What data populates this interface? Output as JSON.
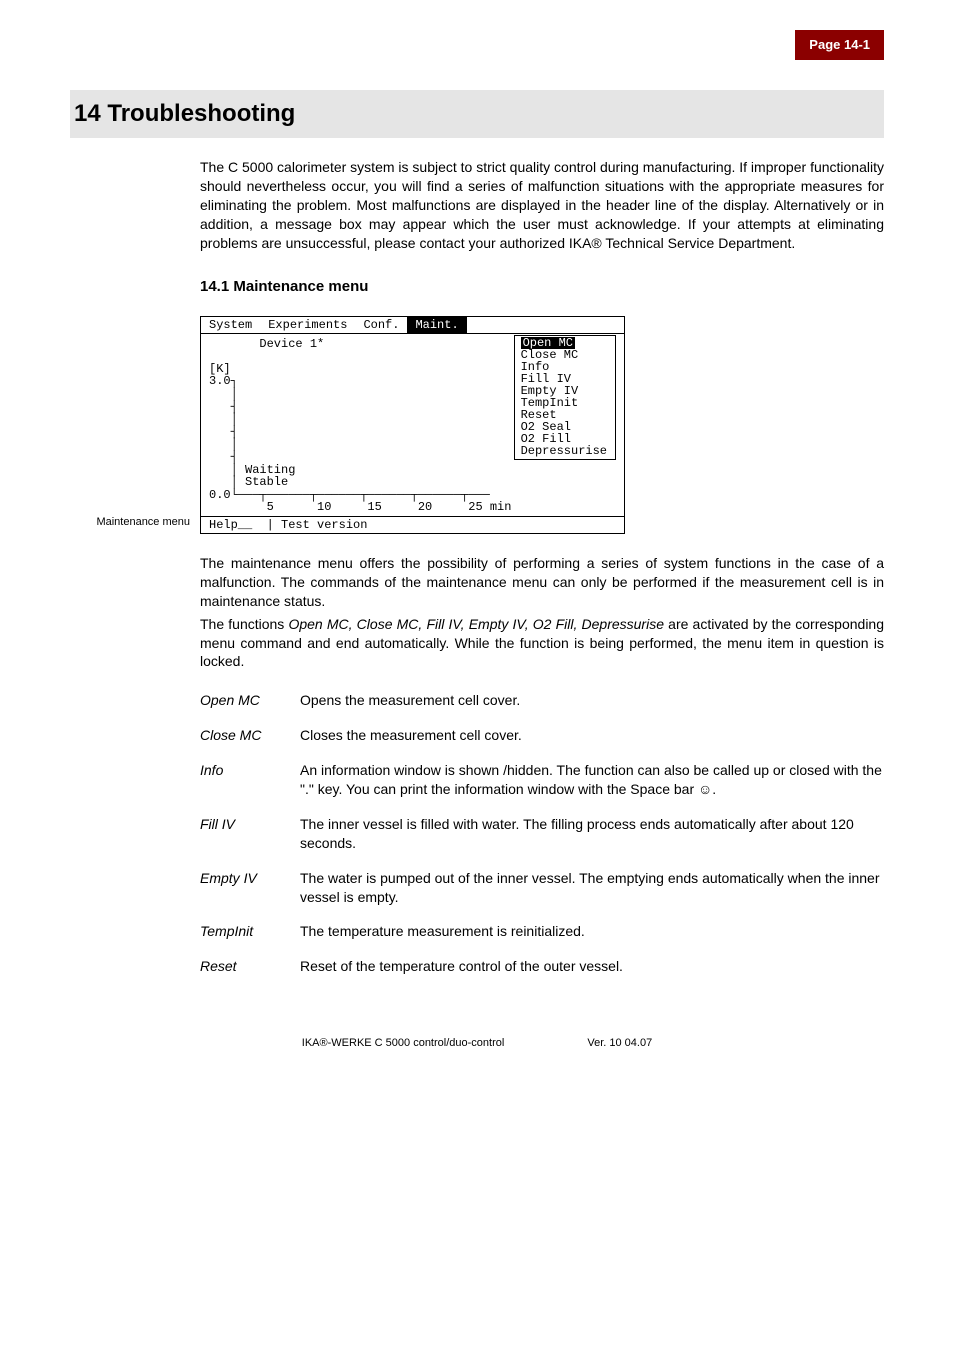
{
  "page_tag": "Page 14-1",
  "h1": "14 Troubleshooting",
  "intro": "The C 5000 calorimeter system is subject to strict quality control during manufacturing. If improper functionality should nevertheless occur, you will find a series of malfunction situations with the appropriate measures for eliminating the problem. Most malfunctions are displayed in the header line of the display. Alternatively or in addition, a message box may appear which the user must acknowledge. If your attempts at eliminating problems are unsuccessful, please contact your authorized IKA® Technical Service Department.",
  "h2": "14.1  Maintenance menu",
  "side_label": "Maintenance menu",
  "screenshot": {
    "menubar": [
      "System",
      "Experiments",
      "Conf.",
      "Maint."
    ],
    "menubar_selected": "Maint.",
    "dropdown_highlight": "Open MC",
    "dropdown_items": [
      "Close MC",
      "Info",
      "Fill  IV",
      "Empty IV",
      "TempInit",
      "Reset",
      "O2  Seal",
      "O2  Fill",
      "Depressurise"
    ],
    "device_label": "Device 1*",
    "y_unit": "[K]",
    "y_top": "3.0",
    "y_bottom": "0.0",
    "status_lines": "Waiting\nStable",
    "x_ticks": "        5      10     15     20     25 min",
    "statusbar": "Help__  | Test version"
  },
  "para1": "The maintenance menu offers the possibility of performing a series of system functions in the case of a malfunction. The commands of the maintenance menu can only be performed if the measurement cell is in maintenance status.",
  "para2_pre": "The functions ",
  "para2_em": "Open MC, Close MC, Fill IV, Empty IV, O2 Fill, Depressurise",
  "para2_post": " are activated by the corresponding menu command and end automatically. While the function is being performed, the menu item in question is locked.",
  "defs": [
    {
      "term": "Open MC",
      "desc": "Opens the measurement cell cover."
    },
    {
      "term": "Close MC",
      "desc": "Closes the measurement cell cover."
    },
    {
      "term": "Info",
      "desc": "An information window is shown /hidden. The function can also be called up or closed with the \".\" key. You can print the information window with the Space bar ☺."
    },
    {
      "term": "Fill IV",
      "desc": "The inner vessel is filled with water. The filling process ends automatically after about 120 seconds."
    },
    {
      "term": "Empty IV",
      "desc": "The water is pumped out of the inner vessel. The emptying ends automatically when the inner vessel is empty."
    },
    {
      "term": "TempInit",
      "desc": "The temperature measurement is reinitialized."
    },
    {
      "term": "Reset",
      "desc": "Reset of the temperature control of the outer vessel."
    }
  ],
  "footer_left": "IKA®-WERKE  C 5000 control/duo-control",
  "footer_right": "Ver. 10 04.07"
}
